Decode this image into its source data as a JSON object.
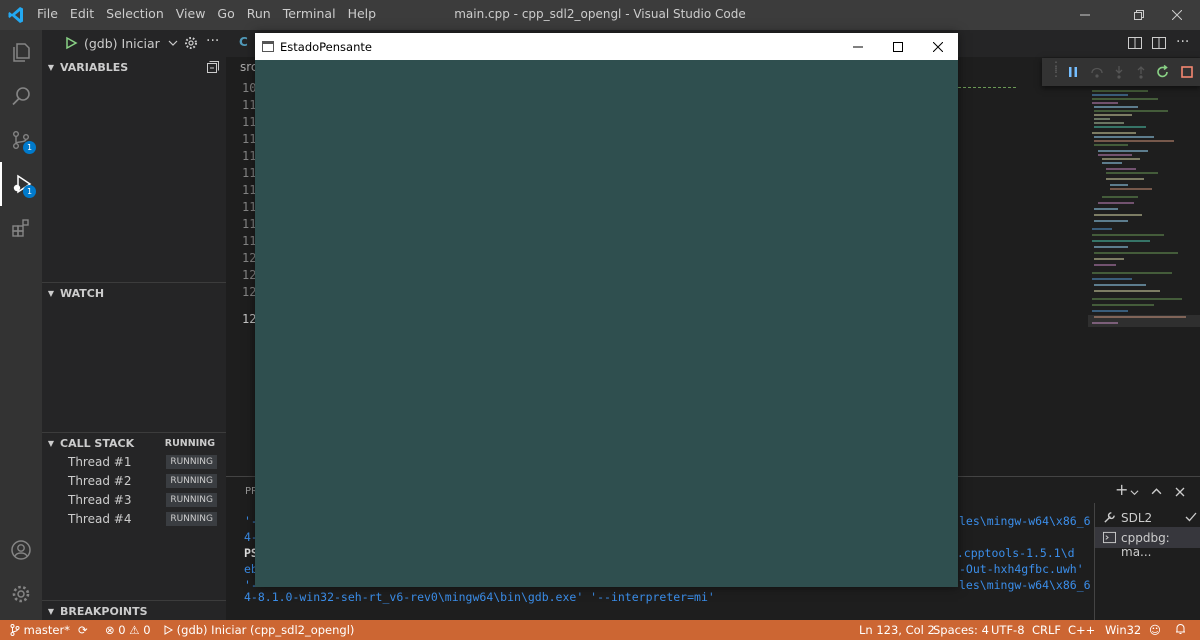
{
  "titlebar": {
    "menu": [
      "File",
      "Edit",
      "Selection",
      "View",
      "Go",
      "Run",
      "Terminal",
      "Help"
    ],
    "title": "main.cpp - cpp_sdl2_opengl - Visual Studio Code"
  },
  "activity": {
    "scm_badge": "1",
    "debug_badge": "1"
  },
  "sidebar": {
    "launch_config": "(gdb) Iniciar",
    "variables_title": "VARIABLES",
    "watch_title": "WATCH",
    "callstack_title": "CALL STACK",
    "callstack_state": "RUNNING",
    "threads": [
      {
        "name": "Thread #1",
        "state": "RUNNING"
      },
      {
        "name": "Thread #2",
        "state": "RUNNING"
      },
      {
        "name": "Thread #3",
        "state": "RUNNING"
      },
      {
        "name": "Thread #4",
        "state": "RUNNING"
      }
    ],
    "breakpoints_title": "BREAKPOINTS"
  },
  "editor": {
    "tab_partial": "src",
    "line_numbers": [
      "10",
      "11",
      "11",
      "11",
      "11",
      "11",
      "11",
      "11",
      "11",
      "11",
      "12",
      "12",
      "12",
      "12"
    ]
  },
  "panel": {
    "tab_partial": "PR",
    "terminal_left": [
      "'-",
      "4-",
      "PS",
      "eb",
      "'-"
    ],
    "terminal_right": [
      "les\\mingw-w64\\x86_6",
      "",
      "",
      "de.cpptools-1.5.1\\d",
      "-Out-hxh4gfbc.uwh'",
      "les\\mingw-w64\\x86_6"
    ],
    "terminal_last": "4-8.1.0-win32-seh-rt_v6-rev0\\mingw64\\bin\\gdb.exe' '--interpreter=mi'",
    "terminals": [
      {
        "label": "SDL2"
      },
      {
        "label": "cppdbg: ma..."
      }
    ]
  },
  "statusbar": {
    "branch": "master*",
    "errors": "0",
    "warnings": "0",
    "debug_config": "(gdb) Iniciar (cpp_sdl2_opengl)",
    "position": "Ln 123, Col 2",
    "spaces": "Spaces: 4",
    "encoding": "UTF-8",
    "eol": "CRLF",
    "language": "C++",
    "platform": "Win32"
  },
  "appwindow": {
    "title": "EstadoPensante",
    "background": "#2f4f4f"
  },
  "colors": {
    "statusbar": "#cc6633",
    "accent": "#007acc",
    "terminal_text": "#3b8eea"
  }
}
